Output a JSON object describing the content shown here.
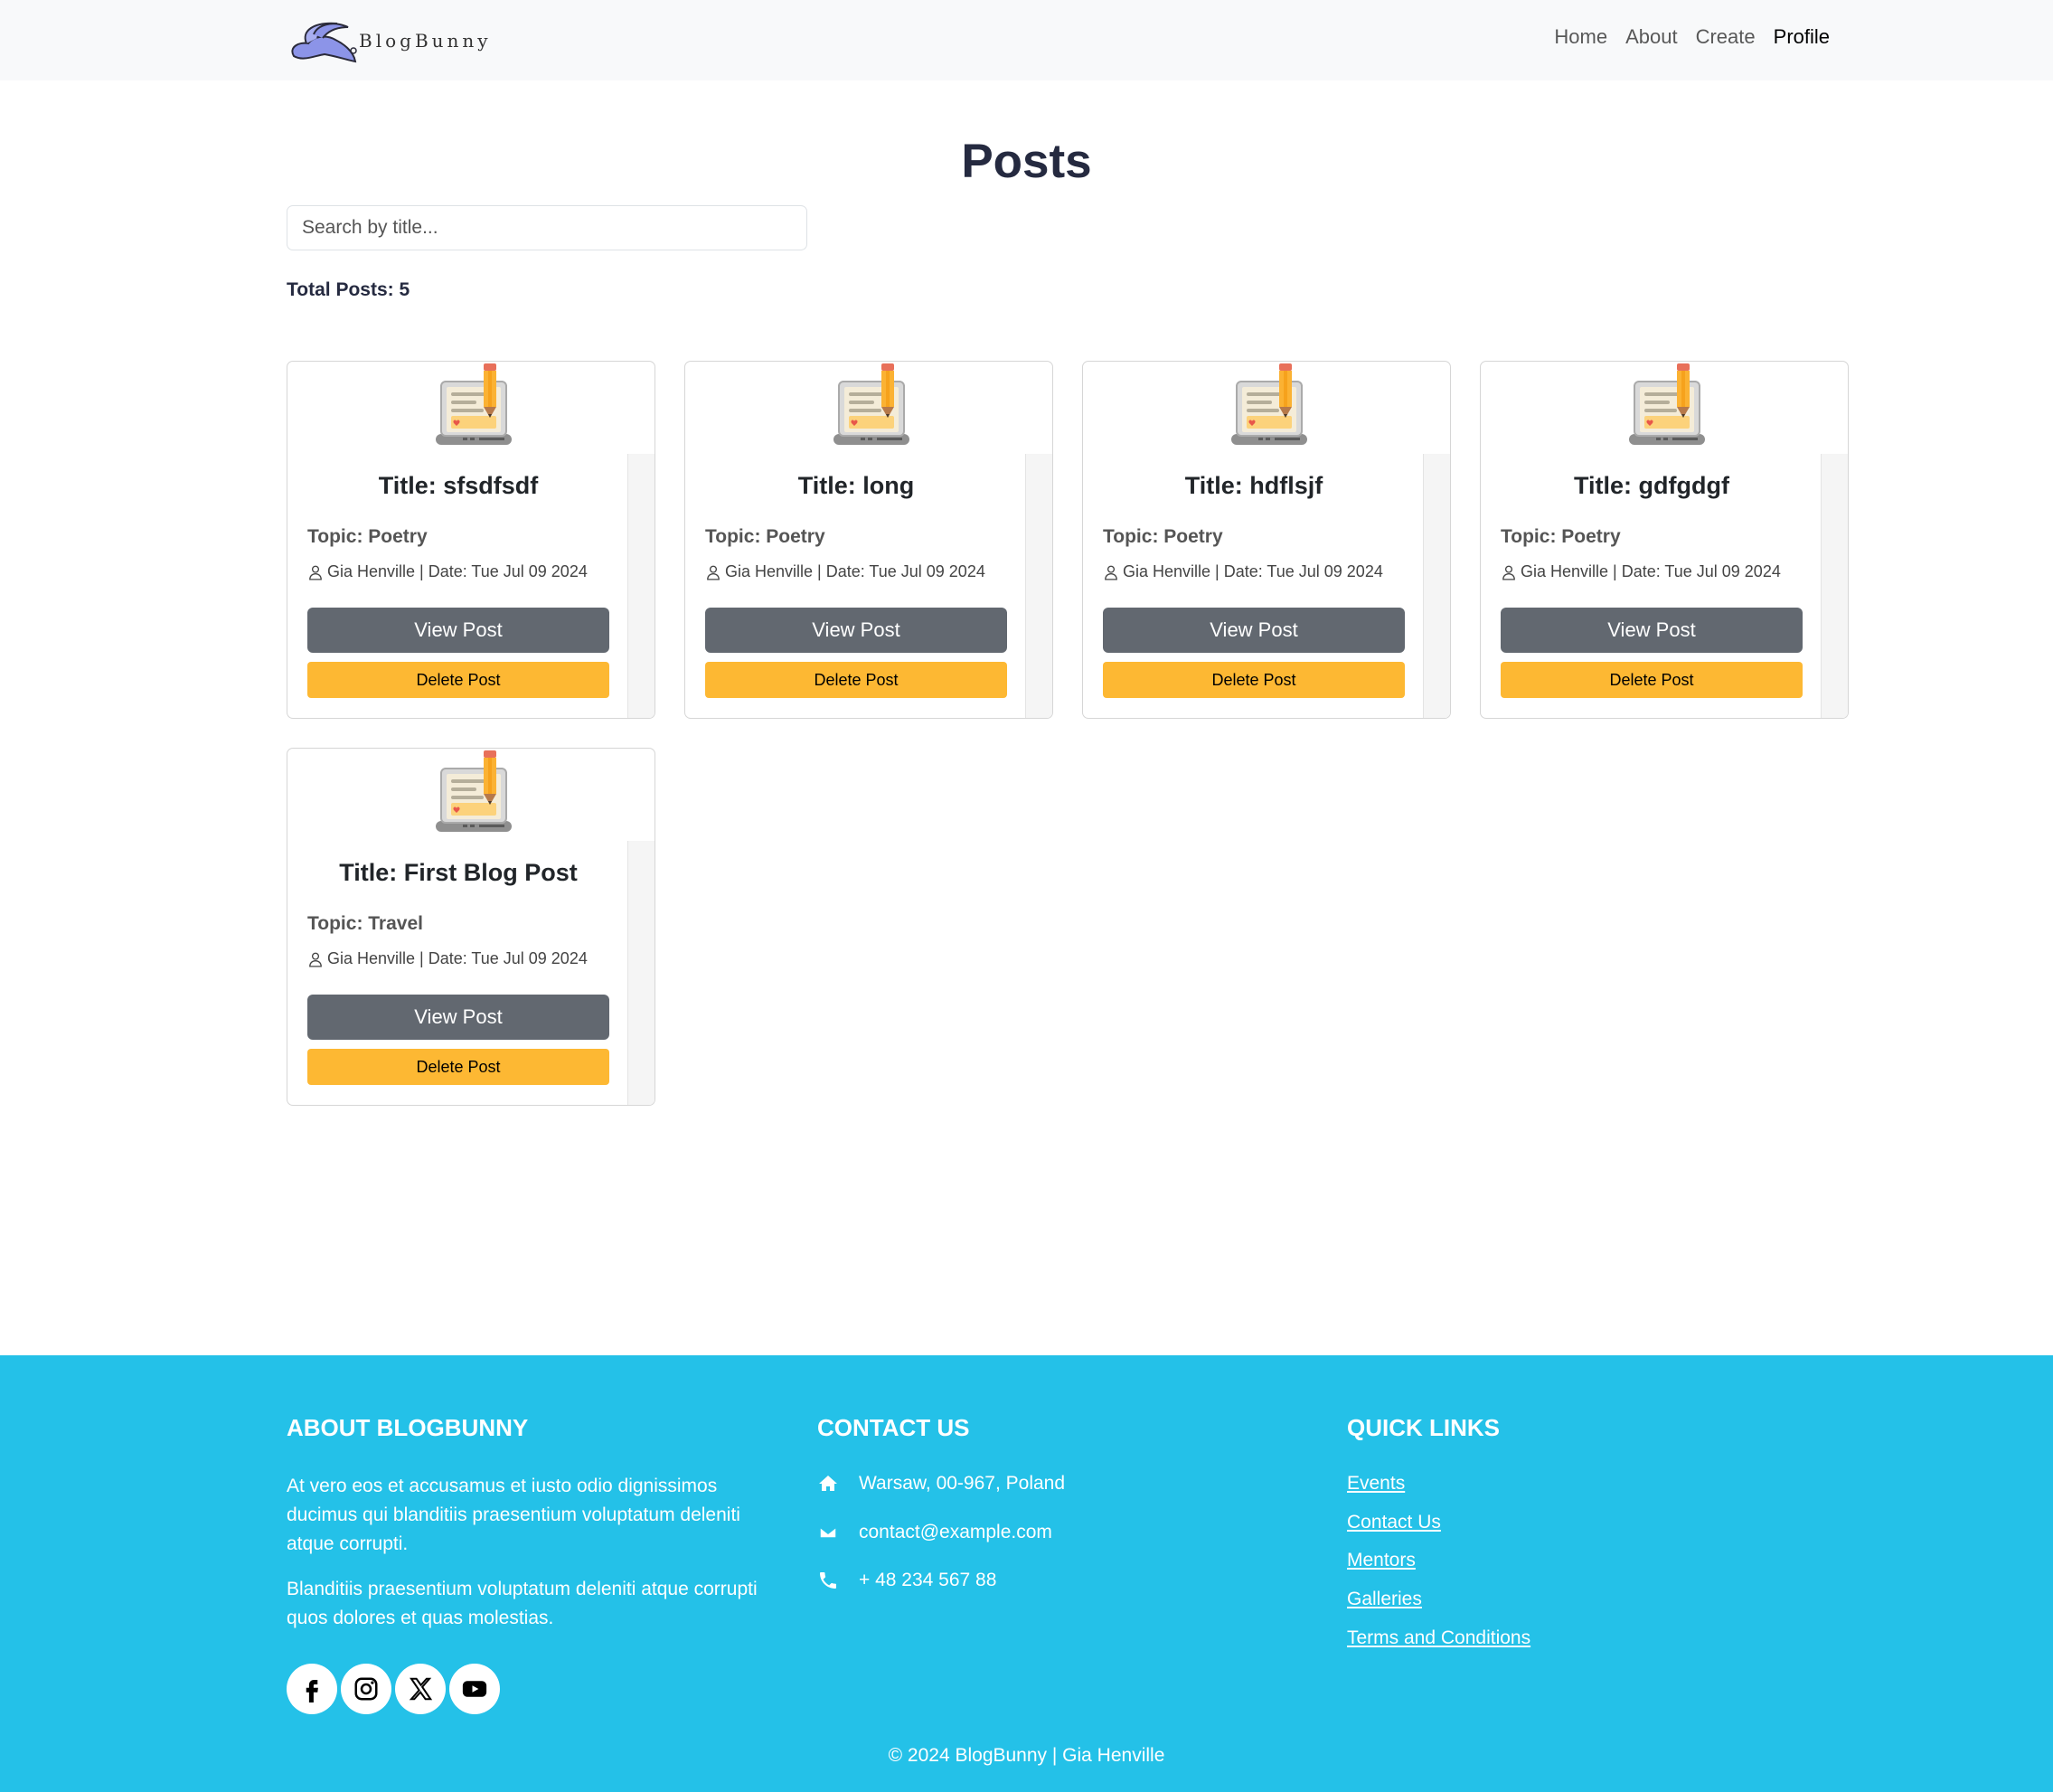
{
  "navbar": {
    "brand": "BlogBunny",
    "links": [
      {
        "label": "Home",
        "active": false
      },
      {
        "label": "About",
        "active": false
      },
      {
        "label": "Create",
        "active": false
      },
      {
        "label": "Profile",
        "active": true
      }
    ]
  },
  "main": {
    "title": "Posts",
    "search_placeholder": "Search by title...",
    "total_posts": "Total Posts: 5",
    "posts": [
      {
        "title": "Title: sfsdfsdf",
        "topic": "Topic: Poetry",
        "meta": "Gia Henville | Date: Tue Jul 09 2024",
        "view_label": "View Post",
        "delete_label": "Delete Post"
      },
      {
        "title": "Title: long",
        "topic": "Topic: Poetry",
        "meta": "Gia Henville | Date: Tue Jul 09 2024",
        "view_label": "View Post",
        "delete_label": "Delete Post"
      },
      {
        "title": "Title: hdflsjf",
        "topic": "Topic: Poetry",
        "meta": "Gia Henville | Date: Tue Jul 09 2024",
        "view_label": "View Post",
        "delete_label": "Delete Post"
      },
      {
        "title": "Title: gdfgdgf",
        "topic": "Topic: Poetry",
        "meta": "Gia Henville | Date: Tue Jul 09 2024",
        "view_label": "View Post",
        "delete_label": "Delete Post"
      },
      {
        "title": "Title: First Blog Post",
        "topic": "Topic: Travel",
        "meta": "Gia Henville | Date: Tue Jul 09 2024",
        "view_label": "View Post",
        "delete_label": "Delete Post"
      }
    ]
  },
  "footer": {
    "about": {
      "heading": "ABOUT BLOGBUNNY",
      "p1": "At vero eos et accusamus et iusto odio dignissimos ducimus qui blanditiis praesentium voluptatum deleniti atque corrupti.",
      "p2": "Blanditiis praesentium voluptatum deleniti atque corrupti quos dolores et quas molestias.",
      "socials": [
        "facebook-icon",
        "instagram-icon",
        "x-icon",
        "youtube-icon"
      ]
    },
    "contact": {
      "heading": "CONTACT US",
      "address": "Warsaw, 00-967, Poland",
      "email": "contact@example.com",
      "phone": "+ 48 234 567 88"
    },
    "quick_links": {
      "heading": "QUICK LINKS",
      "items": [
        "Events",
        "Contact Us",
        "Mentors",
        "Galleries",
        "Terms and Conditions"
      ]
    },
    "copyright": "© 2024 BlogBunny | Gia Henville"
  },
  "colors": {
    "navbar_bg": "#f8f9fa",
    "footer_bg": "#24c1e8",
    "view_button": "#626870",
    "delete_button": "#fdb833",
    "title_text": "#252a40"
  }
}
